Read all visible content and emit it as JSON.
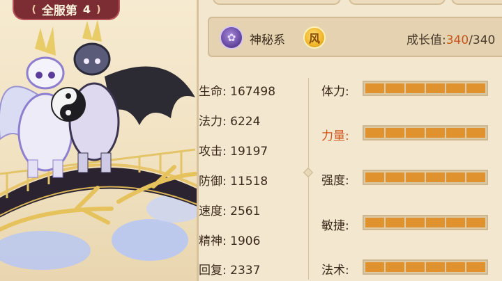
{
  "rank_banner": {
    "left_curl": "(",
    "text": "全服第",
    "number": "4",
    "right_curl": ")"
  },
  "header": {
    "type_label": "神秘系",
    "element_glyph": "风",
    "growth_label": "成长值:",
    "growth_current": "340",
    "growth_sep": "/",
    "growth_max": "340"
  },
  "stats": [
    {
      "label": "生命",
      "value": "167498"
    },
    {
      "label": "法力",
      "value": "6224"
    },
    {
      "label": "攻击",
      "value": "19197"
    },
    {
      "label": "防御",
      "value": "11518"
    },
    {
      "label": "速度",
      "value": "2561"
    },
    {
      "label": "精神",
      "value": "1906"
    },
    {
      "label": "回复",
      "value": "2337"
    }
  ],
  "attributes": [
    {
      "label": "体力:",
      "highlight": false,
      "segments": 6
    },
    {
      "label": "力量:",
      "highlight": true,
      "segments": 6
    },
    {
      "label": "强度:",
      "highlight": false,
      "segments": 6
    },
    {
      "label": "敏捷:",
      "highlight": false,
      "segments": 6
    },
    {
      "label": "法术:",
      "highlight": false,
      "segments": 6
    }
  ],
  "colors": {
    "highlight": "#d4541c",
    "bar_fill": "#e0922f",
    "banner": "#7b2d33"
  },
  "icons": {
    "type_icon": "mystic-lotus-icon",
    "element_icon": "wind-element-icon"
  }
}
